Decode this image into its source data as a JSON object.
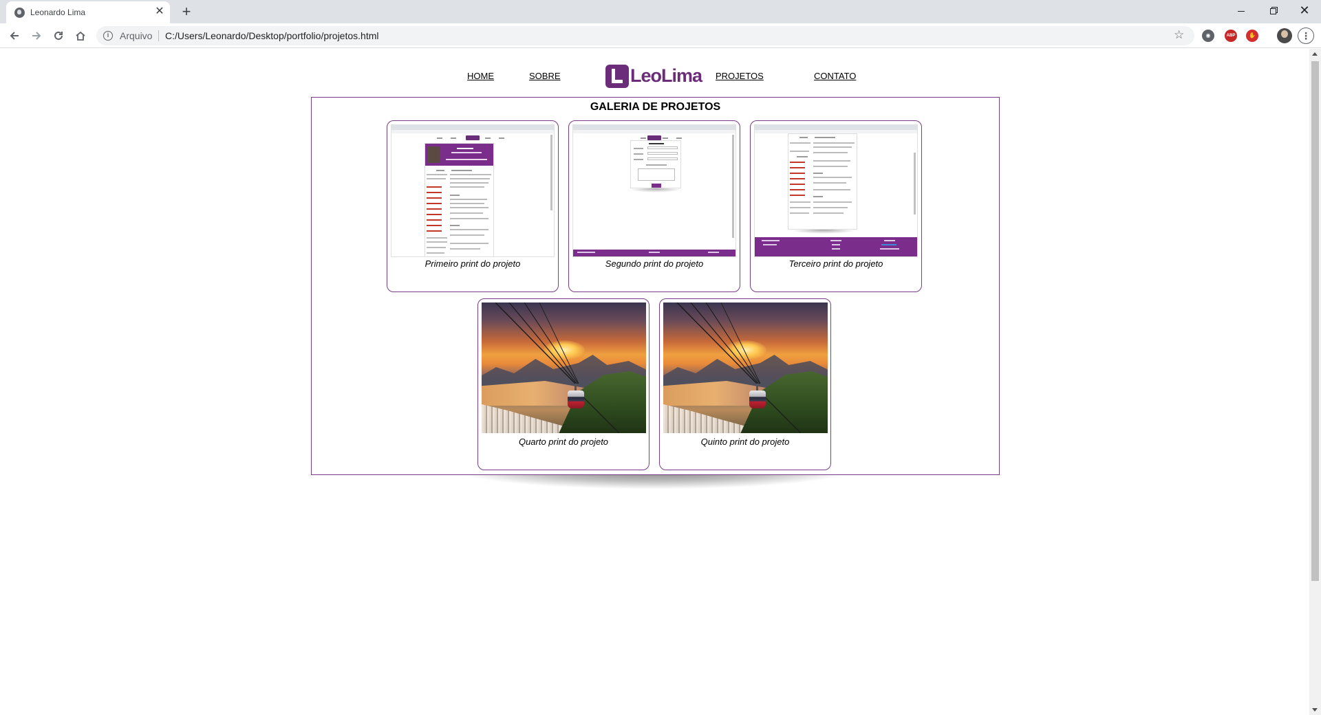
{
  "browser": {
    "tab_title": "Leonardo Lima",
    "tab_close": "✕",
    "new_tab": "+",
    "url_label": "Arquivo",
    "url": "C:/Users/Leonardo/Desktop/portfolio/projetos.html",
    "ext_1": "◉",
    "ext_2": "ABP",
    "ext_3": "✋"
  },
  "site": {
    "nav": {
      "home": "HOME",
      "sobre": "SOBRE",
      "projetos": "PROJETOS",
      "contato": "CONTATO"
    },
    "logo_text": "LeoLima",
    "brand_color": "#6b2c7a",
    "gallery": {
      "title": "GALERIA DE PROJETOS",
      "items": [
        {
          "caption": "Primeiro print do projeto"
        },
        {
          "caption": "Segundo print do projeto"
        },
        {
          "caption": "Terceiro print do projeto"
        },
        {
          "caption": "Quarto print do projeto"
        },
        {
          "caption": "Quinto print do projeto"
        }
      ]
    }
  },
  "icons": {
    "back": "arrow-left-icon",
    "forward": "arrow-right-icon",
    "reload": "reload-icon",
    "home": "home-icon",
    "info": "info-icon",
    "star": "star-icon",
    "menu": "kebab-menu-icon"
  }
}
